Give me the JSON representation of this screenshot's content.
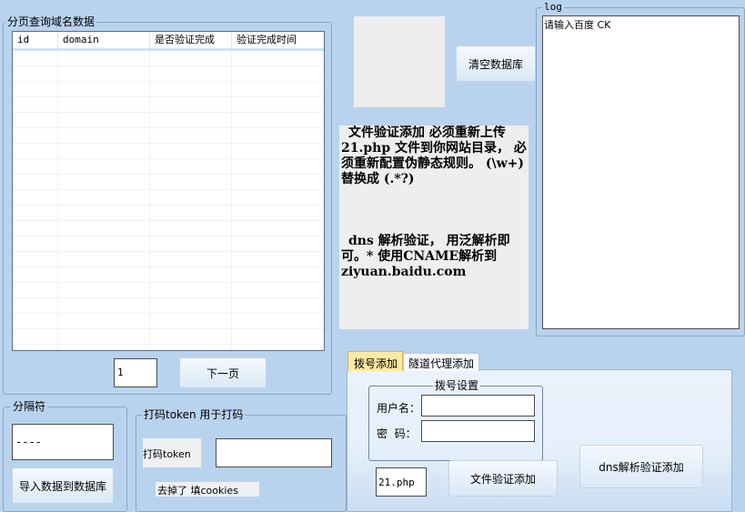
{
  "query_group": {
    "title": "分页查询域名数据",
    "columns": [
      "id",
      "domain",
      "是否验证完成",
      "验证完成时间"
    ],
    "rows_visible": 20,
    "page_value": "1",
    "next_label": "下一页"
  },
  "separator_group": {
    "title": "分隔符",
    "value": "----",
    "import_label": "导入数据到数据库"
  },
  "token_group": {
    "title": "打码token 用于打码",
    "token_label": "打码token",
    "token_value": "",
    "note": "去掉了 填cookies"
  },
  "clear_db_label": "清空数据库",
  "info_text": {
    "file_verify": "文件验证添加 必须重新上传 21.php 文件到你网站目录， 必须重新配置伪静态规则。 (\\w+) 替换成 (.*?)",
    "dns_verify": "dns 解析验证， 用泛解析即可。* 使用CNAME解析到 ziyuan.baidu.com"
  },
  "log": {
    "title": "log",
    "content": "请输入百度 CK"
  },
  "tabs": {
    "dial": "拨号添加",
    "tunnel": "隧道代理添加"
  },
  "dial_settings": {
    "title": "拨号设置",
    "username_label": "用户名：",
    "username_value": "",
    "password_label": "密  码：",
    "password_value": ""
  },
  "php_file_value": "21.php",
  "file_verify_label": "文件验证添加",
  "dns_verify_label": "dns解析验证添加"
}
